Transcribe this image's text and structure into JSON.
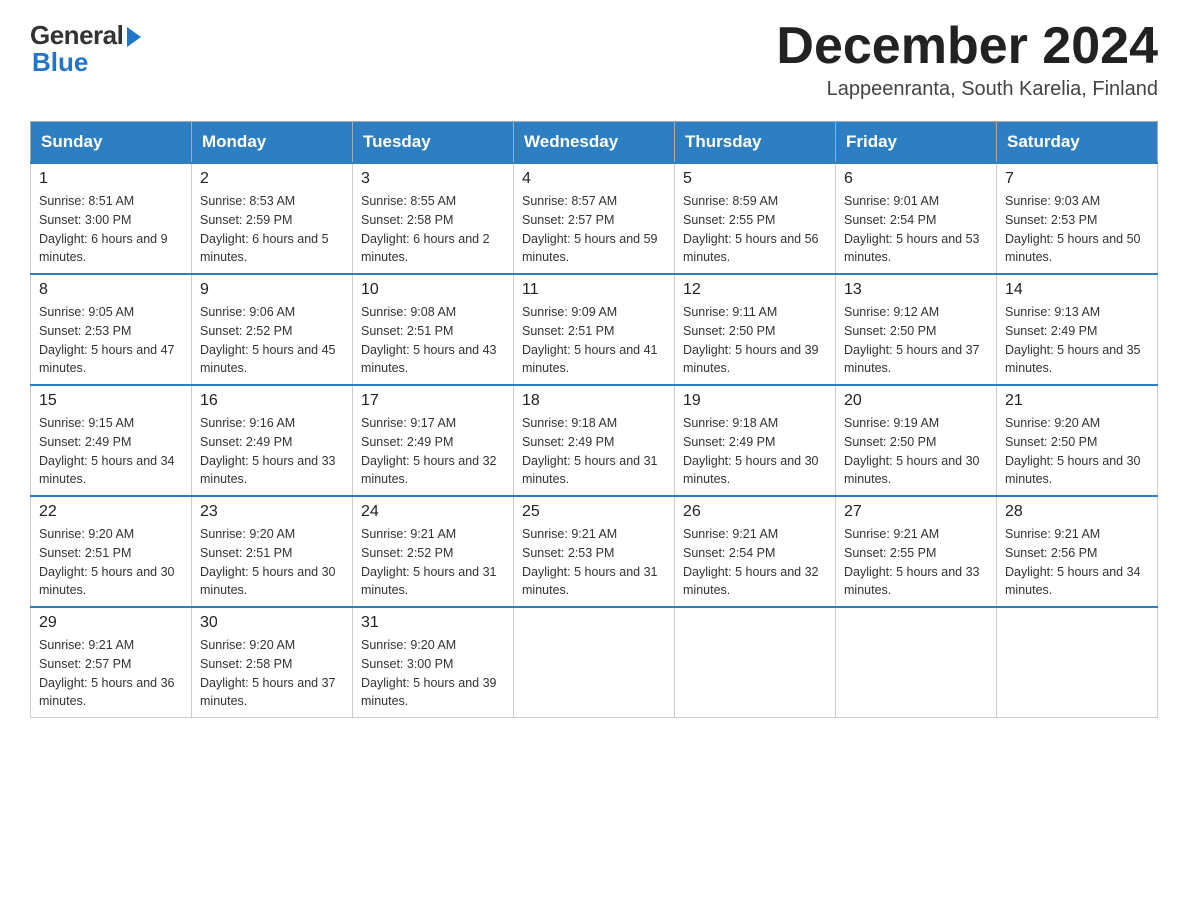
{
  "logo": {
    "general_text": "General",
    "blue_text": "Blue"
  },
  "header": {
    "month_title": "December 2024",
    "location": "Lappeenranta, South Karelia, Finland"
  },
  "weekdays": [
    "Sunday",
    "Monday",
    "Tuesday",
    "Wednesday",
    "Thursday",
    "Friday",
    "Saturday"
  ],
  "weeks": [
    [
      {
        "day": "1",
        "sunrise": "8:51 AM",
        "sunset": "3:00 PM",
        "daylight": "6 hours and 9 minutes."
      },
      {
        "day": "2",
        "sunrise": "8:53 AM",
        "sunset": "2:59 PM",
        "daylight": "6 hours and 5 minutes."
      },
      {
        "day": "3",
        "sunrise": "8:55 AM",
        "sunset": "2:58 PM",
        "daylight": "6 hours and 2 minutes."
      },
      {
        "day": "4",
        "sunrise": "8:57 AM",
        "sunset": "2:57 PM",
        "daylight": "5 hours and 59 minutes."
      },
      {
        "day": "5",
        "sunrise": "8:59 AM",
        "sunset": "2:55 PM",
        "daylight": "5 hours and 56 minutes."
      },
      {
        "day": "6",
        "sunrise": "9:01 AM",
        "sunset": "2:54 PM",
        "daylight": "5 hours and 53 minutes."
      },
      {
        "day": "7",
        "sunrise": "9:03 AM",
        "sunset": "2:53 PM",
        "daylight": "5 hours and 50 minutes."
      }
    ],
    [
      {
        "day": "8",
        "sunrise": "9:05 AM",
        "sunset": "2:53 PM",
        "daylight": "5 hours and 47 minutes."
      },
      {
        "day": "9",
        "sunrise": "9:06 AM",
        "sunset": "2:52 PM",
        "daylight": "5 hours and 45 minutes."
      },
      {
        "day": "10",
        "sunrise": "9:08 AM",
        "sunset": "2:51 PM",
        "daylight": "5 hours and 43 minutes."
      },
      {
        "day": "11",
        "sunrise": "9:09 AM",
        "sunset": "2:51 PM",
        "daylight": "5 hours and 41 minutes."
      },
      {
        "day": "12",
        "sunrise": "9:11 AM",
        "sunset": "2:50 PM",
        "daylight": "5 hours and 39 minutes."
      },
      {
        "day": "13",
        "sunrise": "9:12 AM",
        "sunset": "2:50 PM",
        "daylight": "5 hours and 37 minutes."
      },
      {
        "day": "14",
        "sunrise": "9:13 AM",
        "sunset": "2:49 PM",
        "daylight": "5 hours and 35 minutes."
      }
    ],
    [
      {
        "day": "15",
        "sunrise": "9:15 AM",
        "sunset": "2:49 PM",
        "daylight": "5 hours and 34 minutes."
      },
      {
        "day": "16",
        "sunrise": "9:16 AM",
        "sunset": "2:49 PM",
        "daylight": "5 hours and 33 minutes."
      },
      {
        "day": "17",
        "sunrise": "9:17 AM",
        "sunset": "2:49 PM",
        "daylight": "5 hours and 32 minutes."
      },
      {
        "day": "18",
        "sunrise": "9:18 AM",
        "sunset": "2:49 PM",
        "daylight": "5 hours and 31 minutes."
      },
      {
        "day": "19",
        "sunrise": "9:18 AM",
        "sunset": "2:49 PM",
        "daylight": "5 hours and 30 minutes."
      },
      {
        "day": "20",
        "sunrise": "9:19 AM",
        "sunset": "2:50 PM",
        "daylight": "5 hours and 30 minutes."
      },
      {
        "day": "21",
        "sunrise": "9:20 AM",
        "sunset": "2:50 PM",
        "daylight": "5 hours and 30 minutes."
      }
    ],
    [
      {
        "day": "22",
        "sunrise": "9:20 AM",
        "sunset": "2:51 PM",
        "daylight": "5 hours and 30 minutes."
      },
      {
        "day": "23",
        "sunrise": "9:20 AM",
        "sunset": "2:51 PM",
        "daylight": "5 hours and 30 minutes."
      },
      {
        "day": "24",
        "sunrise": "9:21 AM",
        "sunset": "2:52 PM",
        "daylight": "5 hours and 31 minutes."
      },
      {
        "day": "25",
        "sunrise": "9:21 AM",
        "sunset": "2:53 PM",
        "daylight": "5 hours and 31 minutes."
      },
      {
        "day": "26",
        "sunrise": "9:21 AM",
        "sunset": "2:54 PM",
        "daylight": "5 hours and 32 minutes."
      },
      {
        "day": "27",
        "sunrise": "9:21 AM",
        "sunset": "2:55 PM",
        "daylight": "5 hours and 33 minutes."
      },
      {
        "day": "28",
        "sunrise": "9:21 AM",
        "sunset": "2:56 PM",
        "daylight": "5 hours and 34 minutes."
      }
    ],
    [
      {
        "day": "29",
        "sunrise": "9:21 AM",
        "sunset": "2:57 PM",
        "daylight": "5 hours and 36 minutes."
      },
      {
        "day": "30",
        "sunrise": "9:20 AM",
        "sunset": "2:58 PM",
        "daylight": "5 hours and 37 minutes."
      },
      {
        "day": "31",
        "sunrise": "9:20 AM",
        "sunset": "3:00 PM",
        "daylight": "5 hours and 39 minutes."
      },
      null,
      null,
      null,
      null
    ]
  ],
  "labels": {
    "sunrise": "Sunrise:",
    "sunset": "Sunset:",
    "daylight": "Daylight:"
  }
}
